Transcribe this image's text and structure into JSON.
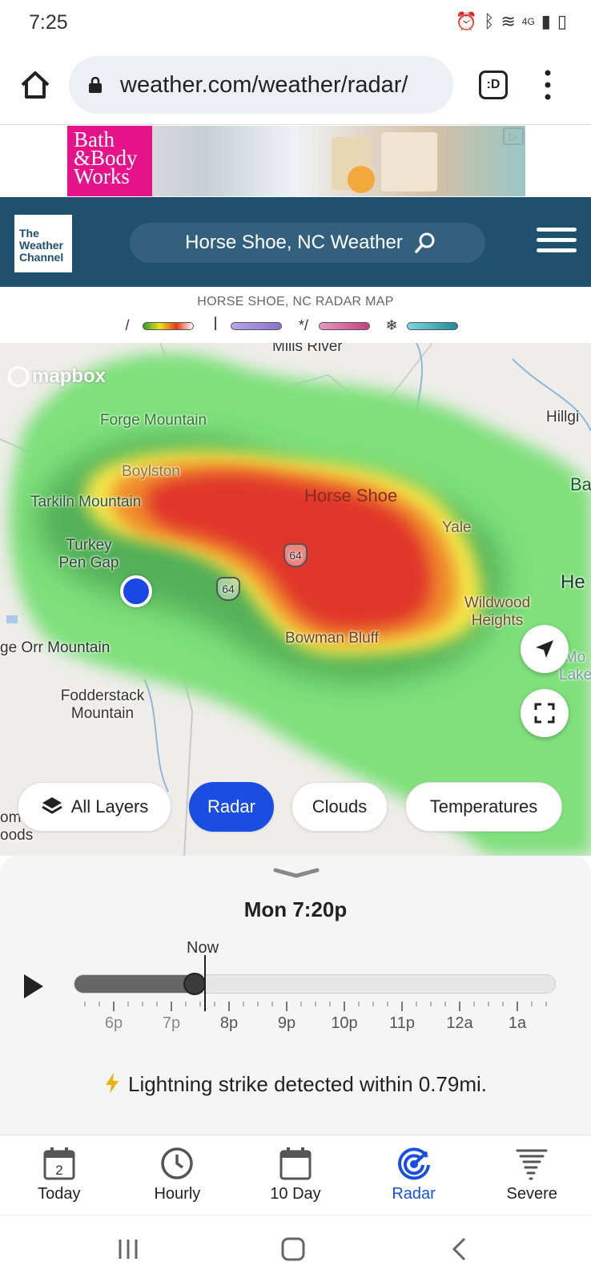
{
  "status_bar": {
    "time": "7:25",
    "network": "4G"
  },
  "browser": {
    "url": "weather.com/weather/radar/",
    "tabs_icon": ":D"
  },
  "ad": {
    "brand_line1": "Bath",
    "brand_line2": "&Body",
    "brand_line3": "Works"
  },
  "header": {
    "logo_line1": "The",
    "logo_line2": "Weather",
    "logo_line3": "Channel",
    "search_text": "Horse Shoe, NC Weather"
  },
  "radar_legend": {
    "title": "HORSE SHOE, NC RADAR MAP",
    "items": [
      {
        "icon": "rain-icon",
        "glyph": "/",
        "gradient": [
          "#2e9d2e",
          "#f0e21a",
          "#e23a1a",
          "#ffffff"
        ]
      },
      {
        "icon": "ice-icon",
        "glyph": "ꟾ",
        "gradient": [
          "#b7a6e8",
          "#8a72d0"
        ]
      },
      {
        "icon": "mix-icon",
        "glyph": "*/",
        "gradient": [
          "#e69ac4",
          "#c3417f"
        ]
      },
      {
        "icon": "snow-icon",
        "glyph": "❄",
        "gradient": [
          "#7fd6df",
          "#1e8a96"
        ]
      }
    ]
  },
  "map": {
    "attribution": "mapbox",
    "labels": [
      "Mills River",
      "Forge Mountain",
      "Hillgi",
      "Boylston",
      "Tarkiln Mountain",
      "Horse Shoe",
      "Yale",
      "Ba",
      "Turkey Pen Gap",
      "64",
      "64",
      "He",
      "Wildwood Heights",
      "Bowman Bluff",
      "ge Orr Mountain",
      "Mo Lake",
      "Fodderstack Mountain",
      "omas oods"
    ]
  },
  "layers": {
    "all": "All Layers",
    "radar": "Radar",
    "clouds": "Clouds",
    "temps": "Temperatures"
  },
  "timeline": {
    "current_time": "Mon 7:20p",
    "now_label": "Now",
    "tick_labels": [
      "6p",
      "7p",
      "8p",
      "9p",
      "10p",
      "11p",
      "12a",
      "1a"
    ],
    "progress_fraction": 0.25
  },
  "alert": {
    "text": "Lightning strike detected within 0.79mi."
  },
  "bottom_nav": [
    {
      "label": "Today",
      "icon": "calendar-day-icon",
      "day": "2"
    },
    {
      "label": "Hourly",
      "icon": "clock-icon"
    },
    {
      "label": "10 Day",
      "icon": "calendar-icon"
    },
    {
      "label": "Radar",
      "icon": "radar-icon"
    },
    {
      "label": "Severe",
      "icon": "tornado-icon"
    }
  ],
  "colors": {
    "accent": "#1a4ee2",
    "header_bg": "#1f506e",
    "location_dot": "#1a47e6",
    "lightning": "#e8b30e"
  }
}
